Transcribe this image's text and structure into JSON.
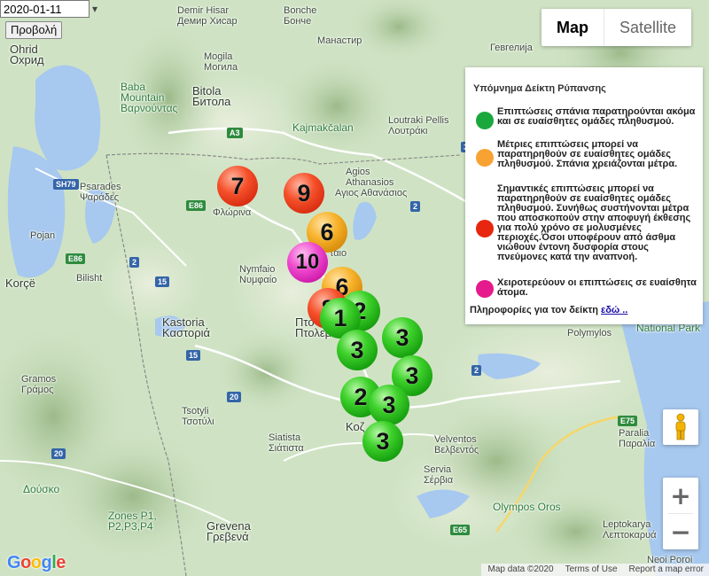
{
  "controls": {
    "date_value": "2020-01-11",
    "view_button": "Προβολή"
  },
  "map_type": {
    "map_label": "Map",
    "satellite_label": "Satellite",
    "selected": "Map"
  },
  "legend": {
    "title": "Υπόμνημα Δείκτη Ρύπανσης",
    "items": [
      {
        "color": "#1aa83c",
        "text": "Επιπτώσεις σπάνια παρατηρούνται ακόμα και σε ευαίσθητες ομάδες πληθυσμού."
      },
      {
        "color": "#f7a233",
        "text": "Μέτριες επιπτώσεις μπορεί να παρατηρηθούν σε ευαίσθητες ομάδες πληθυσμού. Σπάνια χρειάζονται μέτρα."
      },
      {
        "color": "#e8250f",
        "text": "Σημαντικές επιπτώσεις μπορεί να παρατηρηθούν σε ευαίσθητες ομάδες πληθυσμού. Συνήθως συστήνονται μέτρα που αποσκοπούν στην αποφυγή έκθεσης για πολύ χρόνο σε μολυσμένες περιοχές.Όσοι υποφέρουν από άσθμα νιώθουν έντονη δυσφορία στους πνεύμονες κατά την αναπνοή."
      },
      {
        "color": "#e51a8c",
        "text": "Χειροτερεύουν οι επιπτώσεις σε ευαίσθητα άτομα."
      }
    ],
    "info_text": "Πληροφορίες για τον δείκτη",
    "info_link": "εδώ .."
  },
  "markers": [
    {
      "value": "7",
      "level": "red"
    },
    {
      "value": "9",
      "level": "red"
    },
    {
      "value": "6",
      "level": "orange"
    },
    {
      "value": "10",
      "level": "pink"
    },
    {
      "value": "6",
      "level": "orange"
    },
    {
      "value": "8",
      "level": "red"
    },
    {
      "value": "2",
      "level": "green"
    },
    {
      "value": "1",
      "level": "green"
    },
    {
      "value": "3",
      "level": "green"
    },
    {
      "value": "3",
      "level": "green"
    },
    {
      "value": "3",
      "level": "green"
    },
    {
      "value": "2",
      "level": "green"
    },
    {
      "value": "3",
      "level": "green"
    },
    {
      "value": "3",
      "level": "green"
    }
  ],
  "places": {
    "demir_hisar": "Demir Hisar",
    "demir_hisar_cyr": "Демир Хисар",
    "bonche": "Bonche",
    "bonche_cyr": "Бонче",
    "manastir": "Манастир",
    "ohrid": "Ohrid",
    "ohrid_cyr": "Охрид",
    "mogila": "Mogila",
    "mogila_cyr": "Могила",
    "gevgelija_cyr": "Гевгелија",
    "baba_mountain_1": "Baba",
    "baba_mountain_2": "Mountain",
    "varnountas": "Βαρνούντας",
    "bitola": "Bitola",
    "bitola_cyr": "Битола",
    "kajmakcalan": "Kajmakčalan",
    "loutraki": "Loutraki Pellis",
    "loutraki_gr": "Λουτράκι",
    "psarades": "Psarades",
    "psarades_gr": "Ψαράδες",
    "agios": "Agios",
    "athanasios": "Athanasios",
    "athanasios_gr": "Αγιος Αθανάσιος",
    "florina_gr": "Φλώρινα",
    "pojan": "Pojan",
    "bilisht": "Bilisht",
    "korce": "Korçë",
    "nymfaio": "Nymfaio",
    "nymfaio_gr": "Νυμφαίο",
    "ptolemaida": "Πτο",
    "ptolemaida_gr": "Πτολεμ",
    "amyntaio": "ταιο",
    "kastoria": "Kastoria",
    "kastoria_gr": "Καστοριά",
    "gramos": "Gramos",
    "gramos_gr": "Γράμος",
    "national_park": "National Park",
    "polymylos": "Polymylos",
    "tsotyli": "Tsotyli",
    "tsotyli_gr": "Τσοτύλι",
    "siatista": "Siatista",
    "siatista_gr": "Σιάτιστα",
    "kozani": "Κοζ",
    "velventos": "Velventos",
    "velventos_gr": "Βελβεντός",
    "paralia": "Paralia",
    "paralia_gr": "Παραλία",
    "servia": "Servia",
    "servia_gr": "Σέρβια",
    "dousko": "Δούσκο",
    "zones_1": "Zones P1,",
    "zones_2": "P2,P3,P4",
    "grevena": "Grevena",
    "grevena_gr": "Γρεβενά",
    "olympos": "Olympos Oros",
    "leptokarya": "Leptokarya",
    "leptokarya_gr": "Λεπτοκαρυά",
    "neoi_poroi": "Neoi Poroi"
  },
  "shields": {
    "a3": "A3",
    "e86_1": "E86",
    "e86_2": "E86",
    "sh79": "SH79",
    "e75": "E75",
    "e65": "E65",
    "n2": "2",
    "n2b": "2",
    "n15": "15",
    "n15b": "15",
    "n20": "20",
    "n20b": "20",
    "n2c": "2",
    "n3": "3"
  },
  "attribution": {
    "google": "Google",
    "map_data": "Map data ©2020",
    "terms": "Terms of Use",
    "report": "Report a map error"
  }
}
